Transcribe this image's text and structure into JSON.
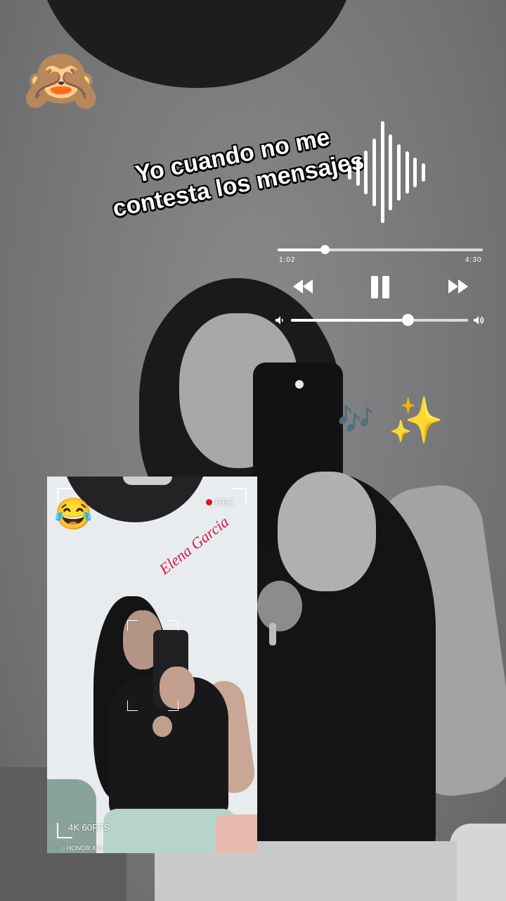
{
  "caption": {
    "line1": "Yo cuando no me",
    "line2": "contesta los mensajes"
  },
  "decorations": {
    "top_left_emoji": "🙈",
    "sparkles_emoji": "✨",
    "notes_emoji": "🎶"
  },
  "player": {
    "elapsed": "1:02",
    "duration": "4:30",
    "progress": 0.23,
    "volume": 0.66,
    "rewind_icon": "rewind-icon",
    "pause_icon": "pause-icon",
    "forward_icon": "fast-forward-icon",
    "volume_low_icon": "speaker-low-icon",
    "volume_high_icon": "speaker-high-icon"
  },
  "inset": {
    "rec_label": "REC",
    "signature": "Elena Garcia",
    "format_label": "4K 60FPS",
    "quality_label": "HD",
    "device_label": "HONOR X6a",
    "emoji": "😂"
  }
}
